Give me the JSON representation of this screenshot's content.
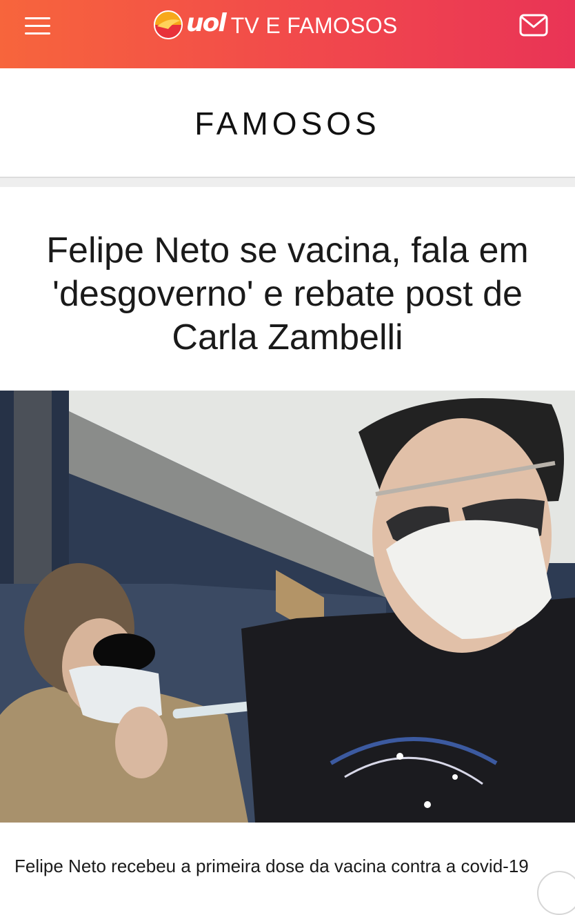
{
  "header": {
    "brand": "uol",
    "section": "TV E FAMOSOS",
    "menu_icon": "hamburger-menu-icon",
    "mail_icon": "envelope-icon",
    "gradient_colors": [
      "#f7653c",
      "#f1484c",
      "#e93456"
    ]
  },
  "category": {
    "title": "FAMOSOS"
  },
  "article": {
    "title": "Felipe Neto se vacina, fala em 'desgoverno' e rebate post de Carla Zambelli",
    "caption": "Felipe Neto recebeu a primeira dose da vacina contra a covid-19"
  }
}
